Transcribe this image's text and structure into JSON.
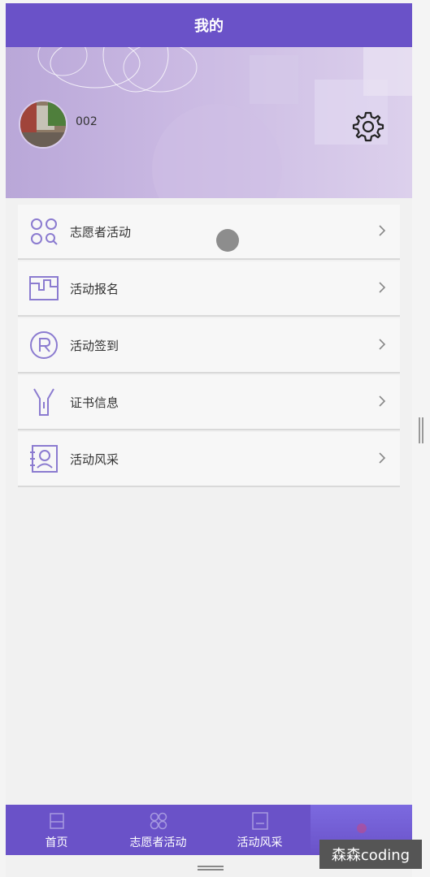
{
  "header": {
    "title": "我的"
  },
  "profile": {
    "username": "002"
  },
  "menu": {
    "items": [
      {
        "label": "志愿者活动",
        "icon": "volunteer-grid-icon"
      },
      {
        "label": "活动报名",
        "icon": "signup-board-icon"
      },
      {
        "label": "活动签到",
        "icon": "checkin-r-icon"
      },
      {
        "label": "证书信息",
        "icon": "certificate-icon"
      },
      {
        "label": "活动风采",
        "icon": "gallery-icon"
      }
    ]
  },
  "tabbar": {
    "tabs": [
      {
        "label": "首页",
        "icon": "home-icon"
      },
      {
        "label": "志愿者活动",
        "icon": "volunteer-grid-icon"
      },
      {
        "label": "活动风采",
        "icon": "gallery-icon"
      }
    ]
  },
  "watermark": {
    "text": "森森coding"
  },
  "colors": {
    "primary": "#6a52c8",
    "icon": "#8b7bd0",
    "background": "#f1f1f1"
  }
}
